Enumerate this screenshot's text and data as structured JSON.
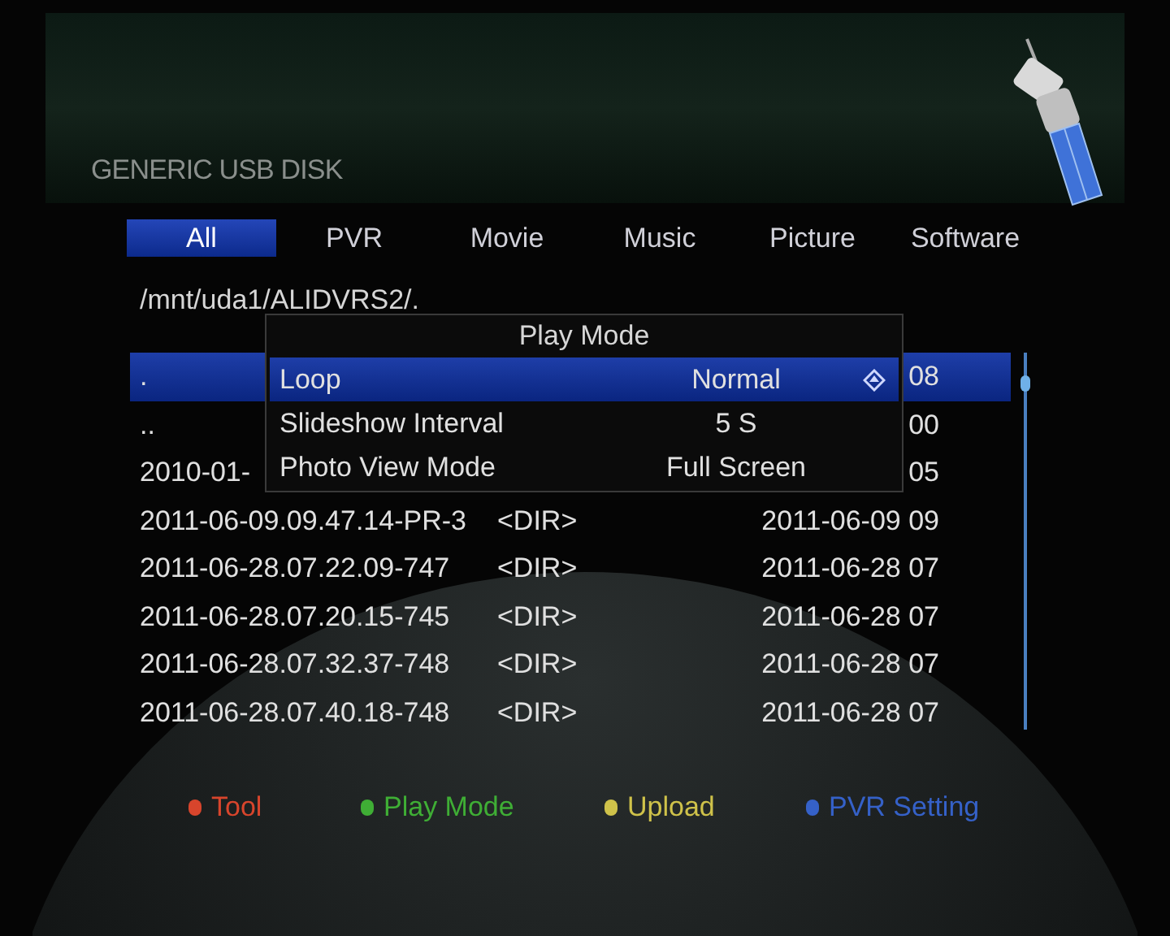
{
  "header": {
    "title": "GENERIC USB DISK"
  },
  "tabs": [
    {
      "label": "All",
      "selected": true
    },
    {
      "label": "PVR",
      "selected": false
    },
    {
      "label": "Movie",
      "selected": false
    },
    {
      "label": "Music",
      "selected": false
    },
    {
      "label": "Picture",
      "selected": false
    },
    {
      "label": "Software",
      "selected": false
    }
  ],
  "path": "/mnt/uda1/ALIDVRS2/.",
  "files": [
    {
      "name": ".",
      "date": "08",
      "selected": true
    },
    {
      "name": "..",
      "date": "00",
      "selected": false
    },
    {
      "name": "2010-01-",
      "date": "05",
      "selected": false
    },
    {
      "name": "2011-06-09.09.47.14-PR-3",
      "type": "<DIR>",
      "date": "2011-06-09 09",
      "selected": false
    },
    {
      "name": "2011-06-28.07.22.09-747",
      "type": "<DIR>",
      "date": "2011-06-28 07",
      "selected": false
    },
    {
      "name": "2011-06-28.07.20.15-745",
      "type": "<DIR>",
      "date": "2011-06-28 07",
      "selected": false
    },
    {
      "name": "2011-06-28.07.32.37-748",
      "type": "<DIR>",
      "date": "2011-06-28 07",
      "selected": false
    },
    {
      "name": "2011-06-28.07.40.18-748",
      "type": "<DIR>",
      "date": "2011-06-28 07",
      "selected": false
    }
  ],
  "popup": {
    "title": "Play Mode",
    "options": [
      {
        "label": "Loop",
        "value": "Normal",
        "selected": true
      },
      {
        "label": "Slideshow Interval",
        "value": "5 S",
        "selected": false
      },
      {
        "label": "Photo View Mode",
        "value": "Full Screen",
        "selected": false
      }
    ]
  },
  "legend": [
    {
      "label": "Tool",
      "color": "#d8452c"
    },
    {
      "label": "Play Mode",
      "color": "#3fae35"
    },
    {
      "label": "Upload",
      "color": "#cfc24a"
    },
    {
      "label": "PVR Setting",
      "color": "#3561c8"
    }
  ]
}
